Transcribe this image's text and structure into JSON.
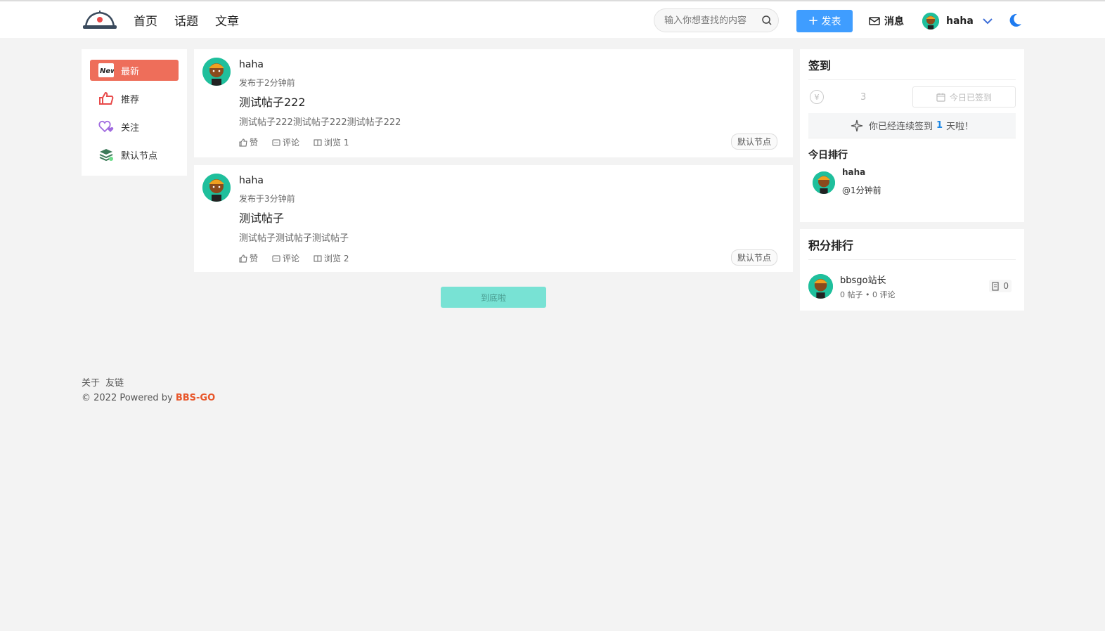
{
  "header": {
    "nav": [
      "首页",
      "话题",
      "文章"
    ],
    "search_placeholder": "输入你想查找的内容",
    "post_button": "发表",
    "messages": "消息",
    "username": "haha"
  },
  "sidebar": {
    "items": [
      {
        "label": "最新",
        "icon": "new-badge-icon",
        "active": true
      },
      {
        "label": "推荐",
        "icon": "thumbs-up-icon",
        "active": false
      },
      {
        "label": "关注",
        "icon": "hearts-icon",
        "active": false
      },
      {
        "label": "默认节点",
        "icon": "layers-icon",
        "active": false
      }
    ]
  },
  "posts": [
    {
      "author": "haha",
      "time": "发布于2分钟前",
      "title": "测试帖子222",
      "summary": "测试帖子222测试帖子222测试帖子222",
      "like": "赞",
      "comment": "评论",
      "views": "浏览 1",
      "tag": "默认节点"
    },
    {
      "author": "haha",
      "time": "发布于3分钟前",
      "title": "测试帖子",
      "summary": "测试帖子测试帖子测试帖子",
      "like": "赞",
      "comment": "评论",
      "views": "浏览 2",
      "tag": "默认节点"
    }
  ],
  "end_label": "到底啦",
  "signin": {
    "title": "签到",
    "coin_symbol": "¥",
    "count": "3",
    "signed_label": "今日已签到",
    "streak_prefix": "你已经连续签到",
    "streak_days": "1",
    "streak_suffix": "天啦！",
    "today_rank_title": "今日排行",
    "rank_user": "haha",
    "rank_time": "@1分钟前"
  },
  "score_rank": {
    "title": "积分排行",
    "user": "bbsgo站长",
    "stats": "0 帖子 • 0 评论",
    "points": "0"
  },
  "footer": {
    "links": [
      "关于",
      "友链"
    ],
    "copyright": "© 2022 Powered by ",
    "brand": "BBS-GO"
  },
  "colors": {
    "accent_blue": "#3f9dff",
    "active_nav": "#ee6e5a",
    "end_button": "#78e2d4",
    "brand": "#e8562a"
  }
}
